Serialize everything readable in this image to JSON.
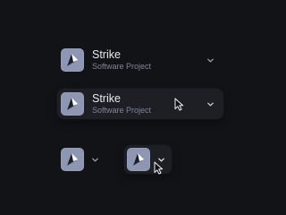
{
  "project": {
    "name": "Strike",
    "subtitle": "Software Project"
  },
  "icons": {
    "logo": "strike-logo",
    "chevron": "chevron-down-icon",
    "cursor": "mouse-pointer-icon"
  },
  "colors": {
    "background": "#121317",
    "hover_surface": "#1d1f25",
    "logo_tile": "#8d96b2",
    "title_text": "#e9eaee",
    "subtitle_text": "#7f869b",
    "chevron": "#9aa1b3"
  },
  "variants": [
    {
      "id": "expanded-default",
      "state": "default"
    },
    {
      "id": "expanded-hover",
      "state": "hover"
    },
    {
      "id": "collapsed-default",
      "state": "default"
    },
    {
      "id": "collapsed-hover",
      "state": "hover"
    }
  ]
}
